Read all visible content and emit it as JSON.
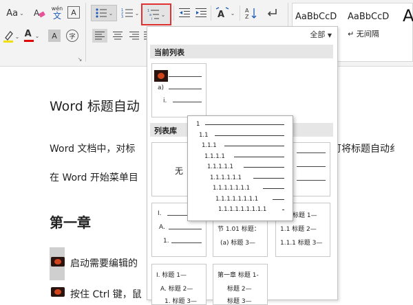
{
  "ribbon": {
    "font_size_glyph": "Aa",
    "phonetic_top": "wén",
    "phonetic_bottom": "文",
    "char_border_glyph": "A",
    "font_color_glyph": "A",
    "char_shading_glyph": "A",
    "enclosed_glyph": "字",
    "styles": [
      {
        "preview": "AaBbCcD",
        "name": ""
      },
      {
        "preview": "AaBbCcD",
        "name": "↵ 无间隔"
      },
      {
        "preview": "A",
        "name": ""
      }
    ],
    "colors": {
      "highlight": "#f0e000",
      "font_red": "#e00000",
      "selected_box": "#e03030"
    }
  },
  "doc": {
    "heading": "Word 标题自动",
    "para1_left": "Word 文档中，对标",
    "para1_right": "可将标题自动纟",
    "para2": "在 Word 开始菜单目",
    "chapter": "第一章",
    "step1": "启动需要编辑的",
    "step2": "按住 Ctrl 键，鼠"
  },
  "dropdown": {
    "all_label": "全部",
    "current_section": "当前列表",
    "library_section": "列表库",
    "current_list": {
      "l2": "a)",
      "l3": "i."
    },
    "none_label": "无",
    "item_r2c1": [
      "I.",
      "A.",
      "1."
    ],
    "item_r2c2": [
      "节 1.01 标题：",
      "(a) 标题 3—"
    ],
    "item_r2c3": [
      "标题 1—",
      "1.1 标题 2—",
      "1.1.1 标题 3—"
    ],
    "item_r3c1": [
      "I. 标题 1—",
      "A. 标题 2—",
      "1. 标题 3—"
    ],
    "item_r3c2": [
      "第一章 标题 1-",
      "标题 2—",
      "标题 3—"
    ]
  },
  "tooltip": {
    "levels": [
      "1",
      "1.1",
      "1.1.1",
      "1.1.1.1",
      "1.1.1.1.1",
      "1.1.1.1.1.1",
      "1.1.1.1.1.1.1",
      "1.1.1.1.1.1.1.1",
      "1.1.1.1.1.1.1.1.1"
    ]
  }
}
